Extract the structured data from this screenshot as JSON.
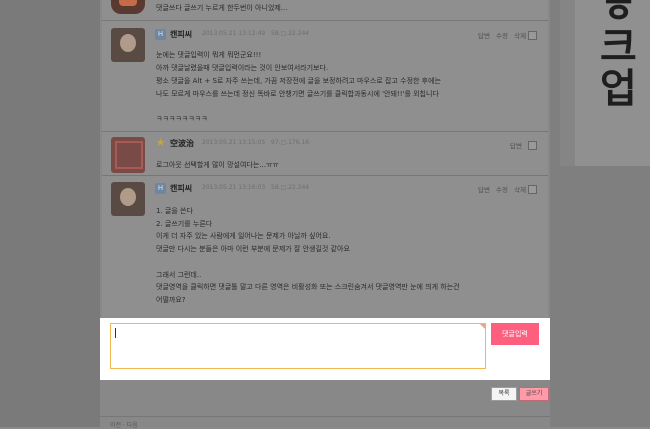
{
  "comments": [
    {
      "id": "c0",
      "text": "댓글쓰다 글쓰기 누르게 한두번이 아니었제...",
      "partial": true
    },
    {
      "id": "c1",
      "author": "캔피씨",
      "date": "2013.05.21 13:12:49",
      "ip": "58.□.22.244",
      "actions": [
        "답변",
        "수정",
        "삭제"
      ],
      "lines": [
        "눈에는 댓글입력이 뭐게 뭐먼군요!!!",
        "아까 댓글날렸을때 댓글입력이라는 것이 안보여서라기보다.",
        "평소 댓글을 Alt + S로 자주 쓰는데, 가끔 저장전에 글을 보정하려고 마우스로 잡고 수정한 후에는",
        "나도 모르게 마우스를 쓰는데 정신 똑바로 안챙기면 글쓰기를 클릭합과동시에 '안돼!!'를 외칩니다",
        "",
        "ㅋㅋㅋㅋㅋㅋㅋㅋ"
      ]
    },
    {
      "id": "c2",
      "author": "空波治",
      "date": "2013.05.21 13:15:05",
      "ip": "97.□.176.16",
      "actions": [
        "답변"
      ],
      "lines": [
        "로그아웃 선택할게 많이 망설여다는...ㅠㅠ"
      ]
    },
    {
      "id": "c3",
      "author": "캔피씨",
      "date": "2013.05.21 13:16:03",
      "ip": "58.□.22.244",
      "actions": [
        "답변",
        "수정",
        "삭제"
      ],
      "lines": [
        "1. 글을 쓴다",
        "2. 글쓰기를 누른다",
        "이게 더 자주 있는 사람에게 일어나는 문제가 아닐까 싶어요.",
        "댓글만 다시는 분들은 아마 이런 부분에 문제가 잘 안생길것 같아요",
        "",
        "그래서 그런데..",
        "댓글영역을 클릭하면 댓글톨 말고 다른 영역은 비활성화 또는 스크린숨겨서 댓글영역만 눈에 띄게 하는건",
        "어떨까요?"
      ]
    }
  ],
  "form": {
    "textarea_value": "",
    "submit_label": "댓글입력"
  },
  "buttons": {
    "list_label": "목록",
    "write_label": "글쓰기"
  },
  "footer": {
    "text": "이전 · 다음"
  },
  "banner": {
    "glyphs": [
      "ㅎ",
      "크",
      "업"
    ]
  },
  "colors": {
    "submit_bg": "#ff5f7f",
    "textarea_border": "#f1b84f",
    "write_bg": "#ff9aa8"
  }
}
